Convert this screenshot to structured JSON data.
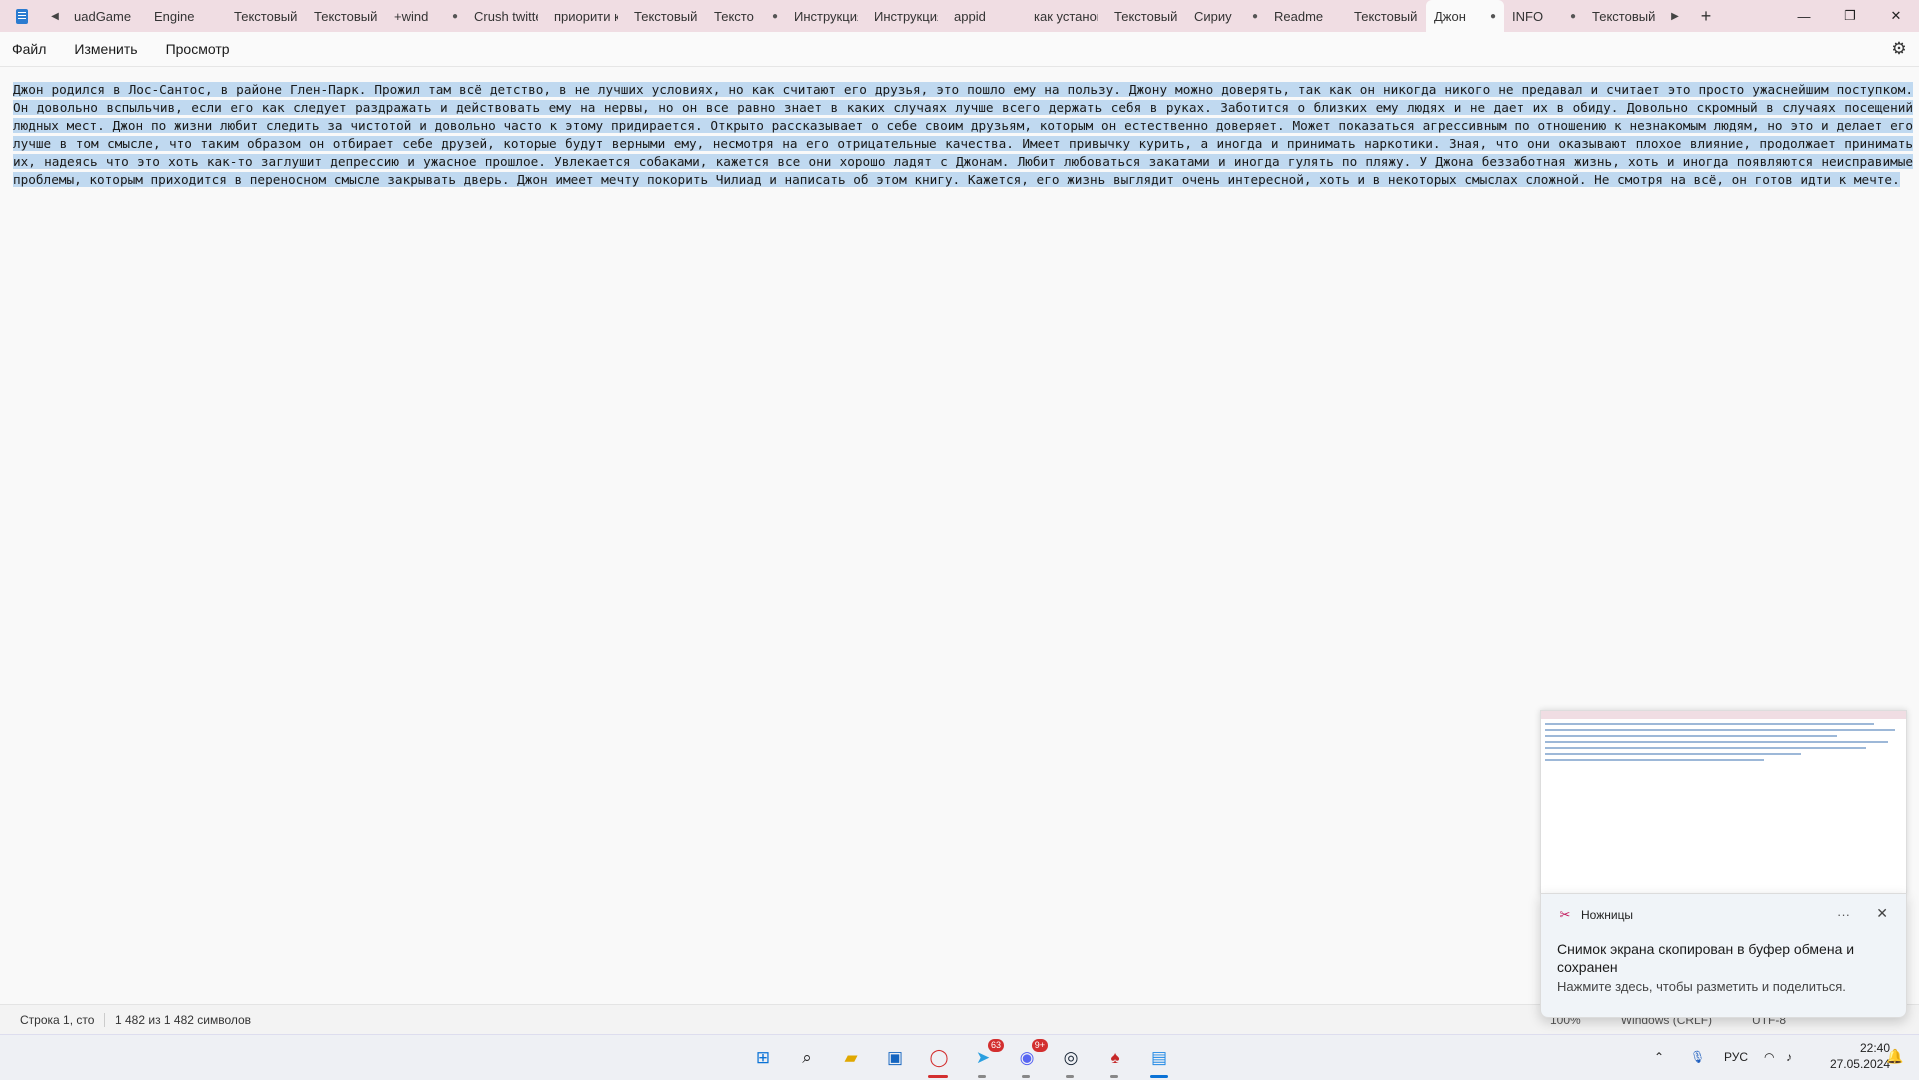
{
  "tabs": [
    {
      "label": "uadGame",
      "modified": false
    },
    {
      "label": "Engine",
      "modified": false
    },
    {
      "label": "Текстовый д",
      "modified": false
    },
    {
      "label": "Текстовый д",
      "modified": false
    },
    {
      "label": "+wind",
      "modified": true
    },
    {
      "label": "Crush twitte",
      "modified": false
    },
    {
      "label": "приорити к",
      "modified": false
    },
    {
      "label": "Текстовый д",
      "modified": false
    },
    {
      "label": "Тексто",
      "modified": true
    },
    {
      "label": "Инструкция",
      "modified": false
    },
    {
      "label": "Инструкция",
      "modified": false
    },
    {
      "label": "appid",
      "modified": false
    },
    {
      "label": "как установ",
      "modified": false
    },
    {
      "label": "Текстовый д",
      "modified": false
    },
    {
      "label": "Сириу",
      "modified": true
    },
    {
      "label": "Readme",
      "modified": false
    },
    {
      "label": "Текстовый д",
      "modified": false
    },
    {
      "label": "Джон",
      "modified": true,
      "active": true
    },
    {
      "label": "INFO",
      "modified": true
    },
    {
      "label": "Текстовый д",
      "modified": false
    }
  ],
  "new_tab_label": "+",
  "menu": {
    "file": "Файл",
    "edit": "Изменить",
    "view": "Просмотр"
  },
  "document": {
    "text": "Джон родился в Лос-Сантос, в районе Глен-Парк. Прожил там всё детство, в не лучших условиях, но как считают его друзья, это пошло ему на пользу. Джону можно доверять, так как он никогда никого не предавал и считает это просто ужаснейшим поступком. Он довольно вспыльчив, если его как следует раздражать и действовать ему на нервы, но он все равно знает в каких случаях лучше всего держать себя в руках. Заботится о близких ему людях и не дает их в обиду. Довольно скромный в случаях посещений людных мест. Джон по жизни любит следить за чистотой и довольно часто к этому придирается. Открыто рассказывает о себе своим друзьям, которым он естественно доверяет. Может показаться агрессивным по отношению к незнакомым людям, но это и делает его лучше в том смысле, что таким образом он отбирает себе друзей, которые будут верными ему, несмотря на его отрицательные качества. Имеет привычку курить, а иногда и принимать наркотики. Зная, что они оказывают плохое влияние, продолжает принимать их, надеясь что это хоть как-то заглушит депрессию и ужасное прошлое. Увлекается собаками, кажется все они хорошо ладят с Джонам. Любит любоваться закатами и иногда гулять по пляжу. У Джона беззаботная жизнь, хоть и иногда появляются неисправимые проблемы, которым приходится в переносном смысле закрывать дверь. Джон имеет мечту покорить Чилиад и написать об этом книгу. Кажется, его жизнь выглядит очень интересной, хоть и в некоторых смыслах сложной. Не смотря на всё, он готов идти к мечте."
  },
  "status": {
    "position": "Строка 1, сто",
    "chars": "1 482 из 1 482 символов",
    "zoom": "100%",
    "line_ending": "Windows (CRLF)",
    "encoding": "UTF-8"
  },
  "toast": {
    "app_name": "Ножницы",
    "title": "Снимок экрана скопирован в буфер обмена и сохранен",
    "subtitle": "Нажмите здесь, чтобы разметить и поделиться.",
    "more_label": "···",
    "close_label": "✕"
  },
  "taskbar": {
    "telegram_badge": "63",
    "discord_badge": "9+"
  },
  "tray": {
    "language": "РУС",
    "time": "22:40",
    "date": "27.05.2024"
  },
  "colors": {
    "tabbar": "#f0dde3",
    "selection": "#c0d9f0",
    "accent": "#0067c0"
  }
}
